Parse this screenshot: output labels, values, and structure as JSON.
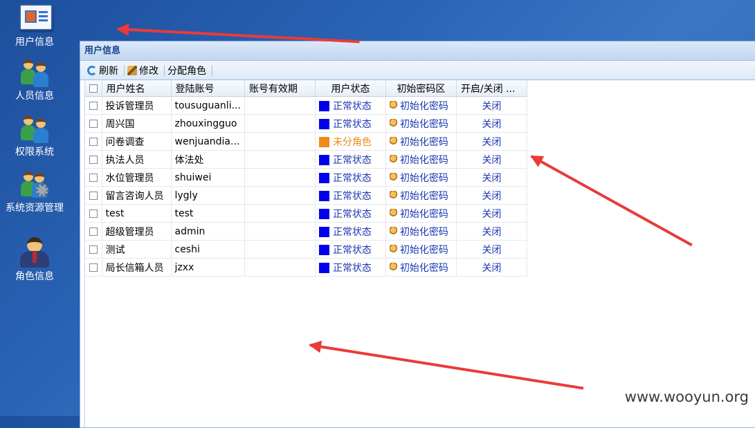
{
  "desktop": {
    "icons": [
      {
        "label": "用户信息",
        "icon": "user-card-icon"
      },
      {
        "label": "人员信息",
        "icon": "people-icon"
      },
      {
        "label": "权限系统",
        "icon": "people-icon"
      },
      {
        "label": "系统资源管理",
        "icon": "people-gear-icon"
      },
      {
        "label": "角色信息",
        "icon": "boss-icon"
      }
    ]
  },
  "window": {
    "title": "用户信息",
    "toolbar": {
      "refresh": "刷新",
      "edit": "修改",
      "assign_role": "分配角色"
    },
    "columns": [
      "用户姓名",
      "登陆账号",
      "账号有效期",
      "用户状态",
      "初始密码区",
      "开启/关闭 ..."
    ],
    "rows": [
      {
        "name": "投诉管理员",
        "account": "tousuguanli...",
        "expiry": "",
        "status": "正常状态",
        "status_type": "normal",
        "init": "初始化密码",
        "toggle": "关闭"
      },
      {
        "name": "周兴国",
        "account": "zhouxingguo",
        "expiry": "",
        "status": "正常状态",
        "status_type": "normal",
        "init": "初始化密码",
        "toggle": "关闭"
      },
      {
        "name": "问卷调查",
        "account": "wenjuandia...",
        "expiry": "",
        "status": "未分角色",
        "status_type": "none",
        "init": "初始化密码",
        "toggle": "关闭"
      },
      {
        "name": "执法人员",
        "account": "体法处",
        "expiry": "",
        "status": "正常状态",
        "status_type": "normal",
        "init": "初始化密码",
        "toggle": "关闭"
      },
      {
        "name": "水位管理员",
        "account": "shuiwei",
        "expiry": "",
        "status": "正常状态",
        "status_type": "normal",
        "init": "初始化密码",
        "toggle": "关闭"
      },
      {
        "name": "留言咨询人员",
        "account": "lygly",
        "expiry": "",
        "status": "正常状态",
        "status_type": "normal",
        "init": "初始化密码",
        "toggle": "关闭"
      },
      {
        "name": "test",
        "account": "test",
        "expiry": "",
        "status": "正常状态",
        "status_type": "normal",
        "init": "初始化密码",
        "toggle": "关闭"
      },
      {
        "name": "超级管理员",
        "account": "admin",
        "expiry": "",
        "status": "正常状态",
        "status_type": "normal",
        "init": "初始化密码",
        "toggle": "关闭"
      },
      {
        "name": "测试",
        "account": "ceshi",
        "expiry": "",
        "status": "正常状态",
        "status_type": "normal",
        "init": "初始化密码",
        "toggle": "关闭"
      },
      {
        "name": "局长信箱人员",
        "account": "jzxx",
        "expiry": "",
        "status": "正常状态",
        "status_type": "normal",
        "init": "初始化密码",
        "toggle": "关闭"
      }
    ]
  },
  "colors": {
    "status_normal": "#0000ee",
    "status_none": "#f08a1a",
    "arrow": "#ea3a3a"
  },
  "watermark": "www.wooyun.org"
}
